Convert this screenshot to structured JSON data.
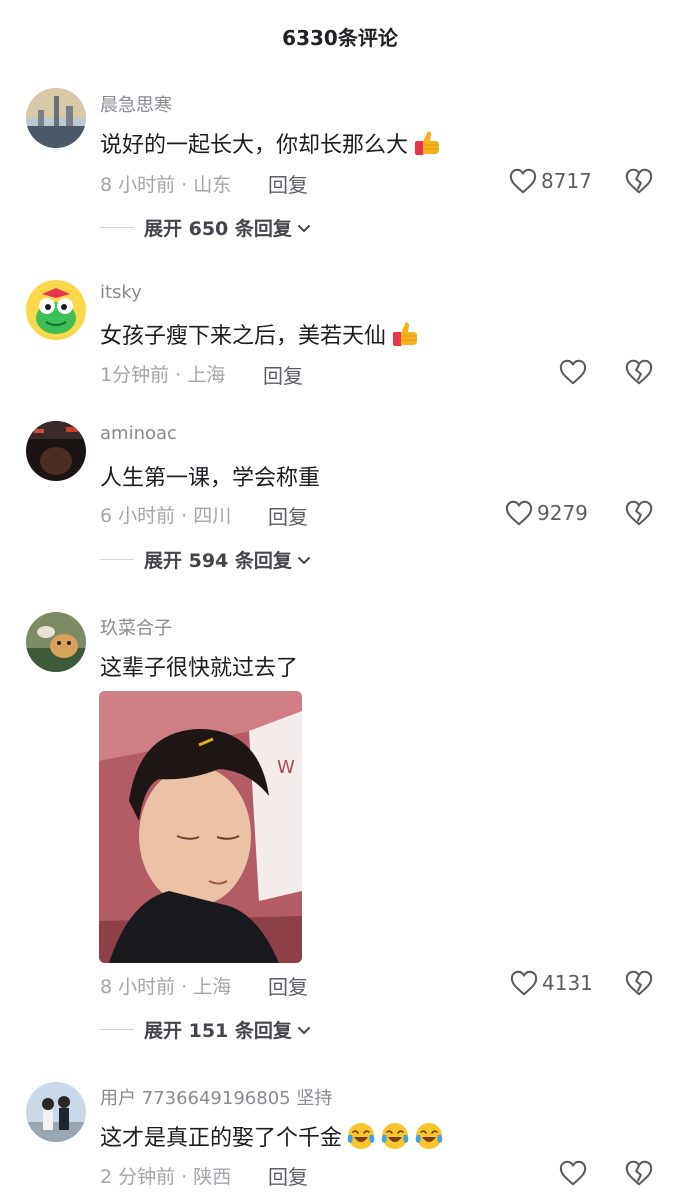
{
  "header": {
    "title": "6330条评论"
  },
  "comments": [
    {
      "username": "晨急思寒",
      "text": "说好的一起长大，你却长那么大",
      "emoji": "thumbs-up",
      "time_location": "8 小时前 · 山东",
      "reply_label": "回复",
      "likes": "8717",
      "expand_label": "展开 650 条回复"
    },
    {
      "username": "itsky",
      "text": "女孩子瘦下来之后，美若天仙",
      "emoji": "thumbs-up",
      "time_location": "1分钟前 · 上海",
      "reply_label": "回复",
      "likes": ""
    },
    {
      "username": "aminoac",
      "text": "人生第一课，学会称重",
      "time_location": "6 小时前 · 四川",
      "reply_label": "回复",
      "likes": "9279",
      "expand_label": "展开 594 条回复"
    },
    {
      "username": "玖菜合子",
      "text": "这辈子很快就过去了",
      "time_location": "8 小时前 · 上海",
      "reply_label": "回复",
      "likes": "4131",
      "expand_label": "展开 151 条回复"
    },
    {
      "username": "用户 7736649196805 坚持",
      "text": "这才是真正的娶了个千金",
      "emoji": "crying-laughing x3",
      "time_location": "2 分钟前 · 陕西",
      "reply_label": "回复",
      "likes": ""
    }
  ],
  "colors": {
    "background": "#ffffff",
    "text": "#1c1c22",
    "muted": "#a4a4ab",
    "thumb": "#f5b21c",
    "cuff": "#e8344a"
  }
}
